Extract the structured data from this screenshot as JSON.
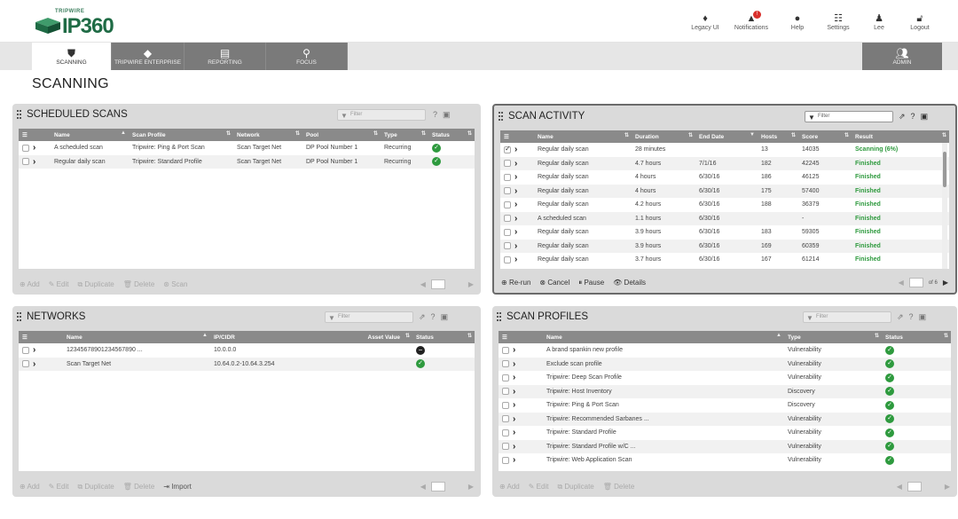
{
  "app": {
    "logo_small": "TRIPWIRE",
    "logo_big": "IP360"
  },
  "top_actions": [
    {
      "label": "Legacy UI",
      "icon": "legacy-icon"
    },
    {
      "label": "Notifications",
      "icon": "bell-icon",
      "badge": "!"
    },
    {
      "label": "Help",
      "icon": "help-icon"
    },
    {
      "label": "Settings",
      "icon": "settings-icon"
    },
    {
      "label": "Lee",
      "icon": "user-icon"
    },
    {
      "label": "Logout",
      "icon": "logout-icon"
    }
  ],
  "nav": {
    "tabs": [
      {
        "label": "SCANNING",
        "icon": "shield-icon"
      },
      {
        "label": "TRIPWIRE ENTERPRISE",
        "icon": "enterprise-icon"
      },
      {
        "label": "REPORTING",
        "icon": "clipboard-icon"
      },
      {
        "label": "FOCUS",
        "icon": "search-icon"
      }
    ],
    "admin": {
      "label": "ADMIN",
      "icon": "users-icon"
    }
  },
  "page_title": "SCANNING",
  "scheduled_scans": {
    "title": "SCHEDULED SCANS",
    "filter_placeholder": "Filter",
    "columns": [
      "",
      "Name",
      "Scan Profile",
      "Network",
      "Pool",
      "Type",
      "Status"
    ],
    "rows": [
      {
        "name": "A scheduled scan",
        "profile": "Tripwire: Ping & Port Scan",
        "network": "Scan Target Net",
        "pool": "DP Pool Number 1",
        "type": "Recurring",
        "status": "ok"
      },
      {
        "name": "Regular daily scan",
        "profile": "Tripwire: Standard Profile",
        "network": "Scan Target Net",
        "pool": "DP Pool Number 1",
        "type": "Recurring",
        "status": "ok"
      }
    ],
    "footer": [
      "Add",
      "Edit",
      "Duplicate",
      "Delete",
      "Scan"
    ]
  },
  "scan_activity": {
    "title": "SCAN ACTIVITY",
    "filter_placeholder": "Filter",
    "columns": [
      "",
      "Name",
      "Duration",
      "End Date",
      "Hosts",
      "Score",
      "Result"
    ],
    "rows": [
      {
        "checked": true,
        "name": "Regular daily scan",
        "duration": "28 minutes",
        "end": "",
        "hosts": "13",
        "score": "14035",
        "result": "Scanning (6%)"
      },
      {
        "checked": false,
        "name": "Regular daily scan",
        "duration": "4.7 hours",
        "end": "7/1/16",
        "hosts": "182",
        "score": "42245",
        "result": "Finished"
      },
      {
        "checked": false,
        "name": "Regular daily scan",
        "duration": "4 hours",
        "end": "6/30/16",
        "hosts": "186",
        "score": "46125",
        "result": "Finished"
      },
      {
        "checked": false,
        "name": "Regular daily scan",
        "duration": "4 hours",
        "end": "6/30/16",
        "hosts": "175",
        "score": "57400",
        "result": "Finished"
      },
      {
        "checked": false,
        "name": "Regular daily scan",
        "duration": "4.2 hours",
        "end": "6/30/16",
        "hosts": "188",
        "score": "36379",
        "result": "Finished"
      },
      {
        "checked": false,
        "name": "A scheduled scan",
        "duration": "1.1 hours",
        "end": "6/30/16",
        "hosts": "",
        "score": "-",
        "result": "Finished"
      },
      {
        "checked": false,
        "name": "Regular daily scan",
        "duration": "3.9 hours",
        "end": "6/30/16",
        "hosts": "183",
        "score": "59305",
        "result": "Finished"
      },
      {
        "checked": false,
        "name": "Regular daily scan",
        "duration": "3.9 hours",
        "end": "6/30/16",
        "hosts": "169",
        "score": "60359",
        "result": "Finished"
      },
      {
        "checked": false,
        "name": "Regular daily scan",
        "duration": "3.7 hours",
        "end": "6/30/16",
        "hosts": "167",
        "score": "61214",
        "result": "Finished"
      }
    ],
    "footer": [
      "Re-run",
      "Cancel",
      "Pause",
      "Details"
    ],
    "pager_of": "of 6"
  },
  "networks": {
    "title": "NETWORKS",
    "filter_placeholder": "Filter",
    "columns": [
      "",
      "Name",
      "IP/CIDR",
      "Asset Value",
      "Status"
    ],
    "rows": [
      {
        "name": "12345678901234567890 ...",
        "ip": "10.0.0.0",
        "asset": "",
        "status": "minus"
      },
      {
        "name": "Scan Target Net",
        "ip": "10.64.0.2-10.64.3.254",
        "asset": "",
        "status": "ok"
      }
    ],
    "footer": [
      "Add",
      "Edit",
      "Duplicate",
      "Delete",
      "Import"
    ]
  },
  "scan_profiles": {
    "title": "SCAN PROFILES",
    "filter_placeholder": "Filter",
    "columns": [
      "",
      "Name",
      "Type",
      "Status"
    ],
    "rows": [
      {
        "name": "A brand spankin new profile",
        "type": "Vulnerability"
      },
      {
        "name": "Exclude scan profile",
        "type": "Vulnerability"
      },
      {
        "name": "Tripwire: Deep Scan Profile",
        "type": "Vulnerability"
      },
      {
        "name": "Tripwire: Host Inventory",
        "type": "Discovery"
      },
      {
        "name": "Tripwire: Ping & Port Scan",
        "type": "Discovery"
      },
      {
        "name": "Tripwire: Recommended Sarbanes ...",
        "type": "Vulnerability"
      },
      {
        "name": "Tripwire: Standard Profile",
        "type": "Vulnerability"
      },
      {
        "name": "Tripwire: Standard Profile w/C ...",
        "type": "Vulnerability"
      },
      {
        "name": "Tripwire: Web Application Scan",
        "type": "Vulnerability"
      }
    ],
    "footer": [
      "Add",
      "Edit",
      "Duplicate",
      "Delete"
    ]
  }
}
